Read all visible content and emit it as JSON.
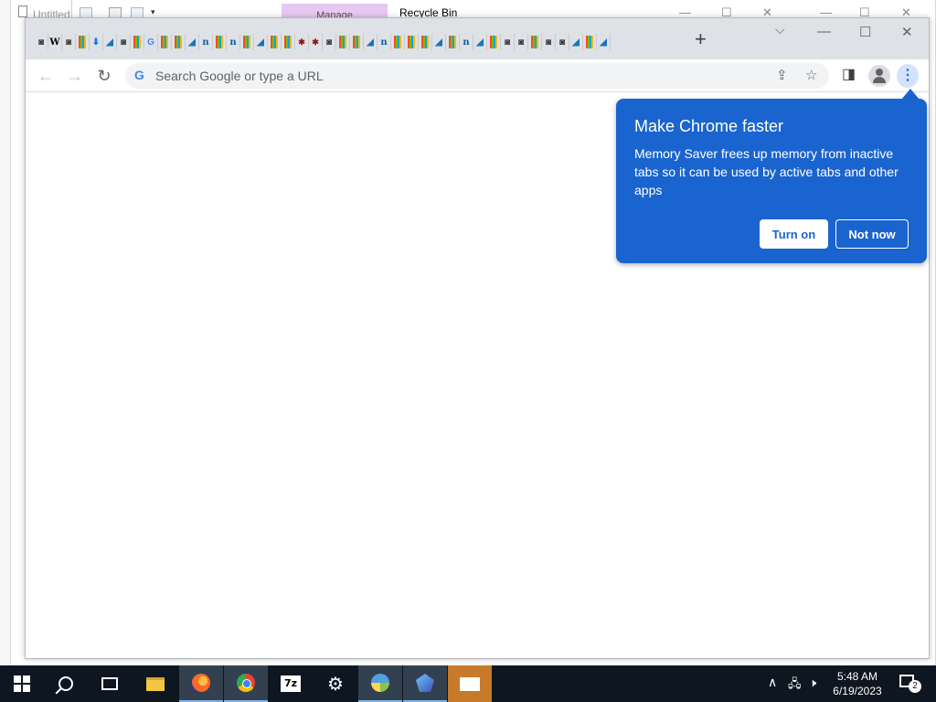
{
  "background_windows": {
    "doc_tab_label": "Untitled",
    "ribbon_tab_label": "Manage",
    "window_title": "Recycle Bin"
  },
  "chrome": {
    "new_tab_label": "+",
    "omnibox": {
      "placeholder": "Search Google or type a URL"
    },
    "promo_bubble": {
      "title": "Make Chrome faster",
      "body": "Memory Saver frees up memory from inactive tabs so it can be used by active tabs and other apps",
      "primary_button": "Turn on",
      "secondary_button": "Not now",
      "background_color": "#1a64cf"
    },
    "tab_icons": [
      "chrome-icon",
      "wikipedia-icon",
      "chrome-icon",
      "microsoft-icon",
      "download-icon",
      "vscode-icon",
      "chrome-icon",
      "microsoft-icon",
      "google-icon",
      "microsoft-icon",
      "microsoft-icon",
      "vscode-icon",
      "nmap-icon",
      "microsoft-icon",
      "nmap-icon",
      "microsoft-icon",
      "vscode-icon",
      "microsoft-icon",
      "microsoft-icon",
      "bug-icon",
      "bug-icon",
      "chrome-icon",
      "microsoft-icon",
      "microsoft-icon",
      "vscode-icon",
      "nmap-icon",
      "microsoft-icon",
      "microsoft-icon",
      "microsoft-icon",
      "vscode-icon",
      "microsoft-icon",
      "nmap-icon",
      "vscode-icon",
      "microsoft-icon",
      "chrome-icon",
      "chrome-icon",
      "microsoft-icon",
      "chrome-icon",
      "chrome-icon",
      "vscode-icon",
      "microsoft-icon",
      "vscode-icon"
    ]
  },
  "taskbar": {
    "apps": [
      "start-icon",
      "search-icon",
      "task-view-icon",
      "file-explorer-icon",
      "firefox-icon",
      "chrome-icon",
      "7zip-icon",
      "settings-icon",
      "ie-icon",
      "security-icon",
      "mail-icon"
    ],
    "clock": {
      "time": "5:48 AM",
      "date": "6/19/2023"
    },
    "notification_count": "2"
  }
}
